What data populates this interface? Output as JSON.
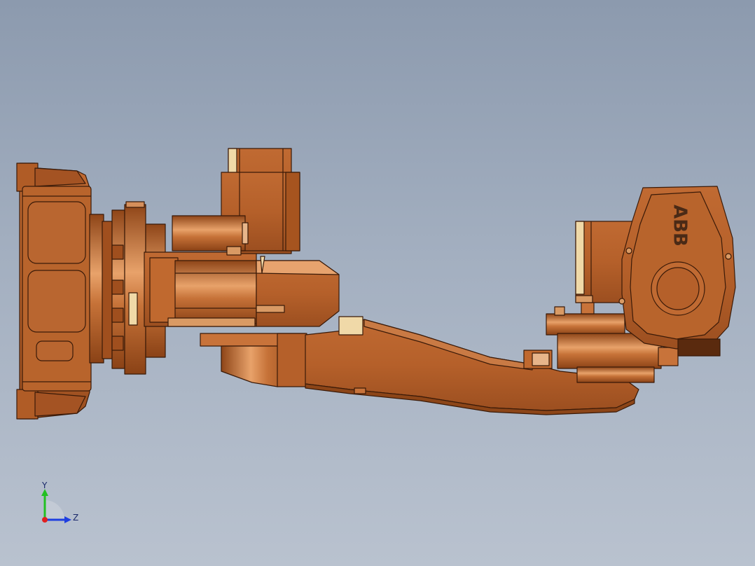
{
  "viewport": {
    "background_top": "#8c9aae",
    "background_bottom": "#b9c2cf"
  },
  "model": {
    "logo_text": "ABB",
    "body_color": "#b8642c",
    "highlight_color": "#e7a36e",
    "edge_color": "#3a1a08",
    "accent_color": "#f0d9a8"
  },
  "triad": {
    "y_label": "Y",
    "z_label": "Z",
    "y_color": "#22c022",
    "z_color": "#1f3fe0",
    "x_color": "#e02020"
  }
}
